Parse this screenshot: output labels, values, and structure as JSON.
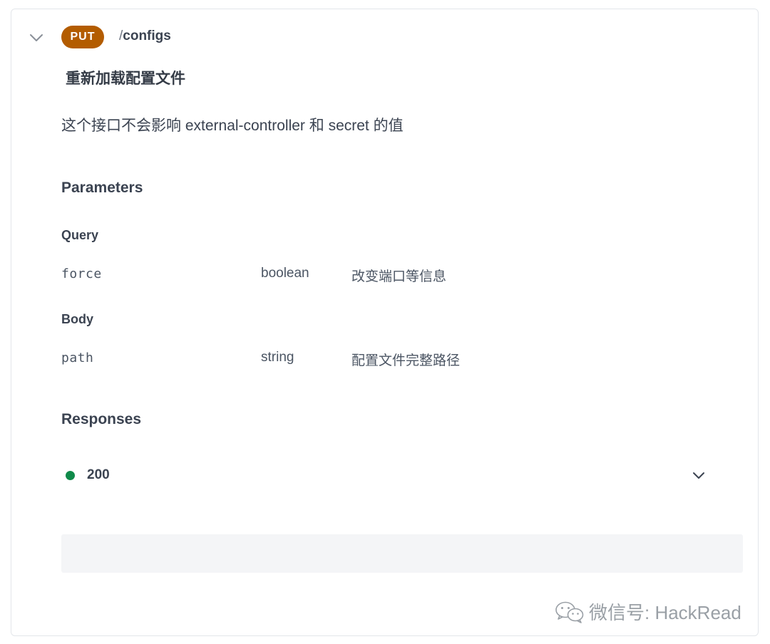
{
  "endpoint": {
    "method": "PUT",
    "path_prefix": "/",
    "path": "configs",
    "summary": "重新加载配置文件",
    "description": "这个接口不会影响 external-controller 和 secret 的值"
  },
  "parameters": {
    "heading": "Parameters",
    "groups": [
      {
        "label": "Query",
        "params": [
          {
            "name": "force",
            "type": "boolean",
            "description": "改变端口等信息"
          }
        ]
      },
      {
        "label": "Body",
        "params": [
          {
            "name": "path",
            "type": "string",
            "description": "配置文件完整路径"
          }
        ]
      }
    ]
  },
  "responses": {
    "heading": "Responses",
    "items": [
      {
        "code": "200",
        "status_color": "#0f8a4a"
      }
    ]
  },
  "watermark": {
    "text": "微信号: HackRead",
    "icon": "wechat-icon"
  },
  "colors": {
    "method_badge": "#b35c00",
    "success": "#0f8a4a",
    "text": "#3b4351",
    "panel": "#f4f5f7"
  },
  "icons": {
    "collapse": "chevron-down-icon",
    "expand_response": "chevron-down-icon"
  }
}
